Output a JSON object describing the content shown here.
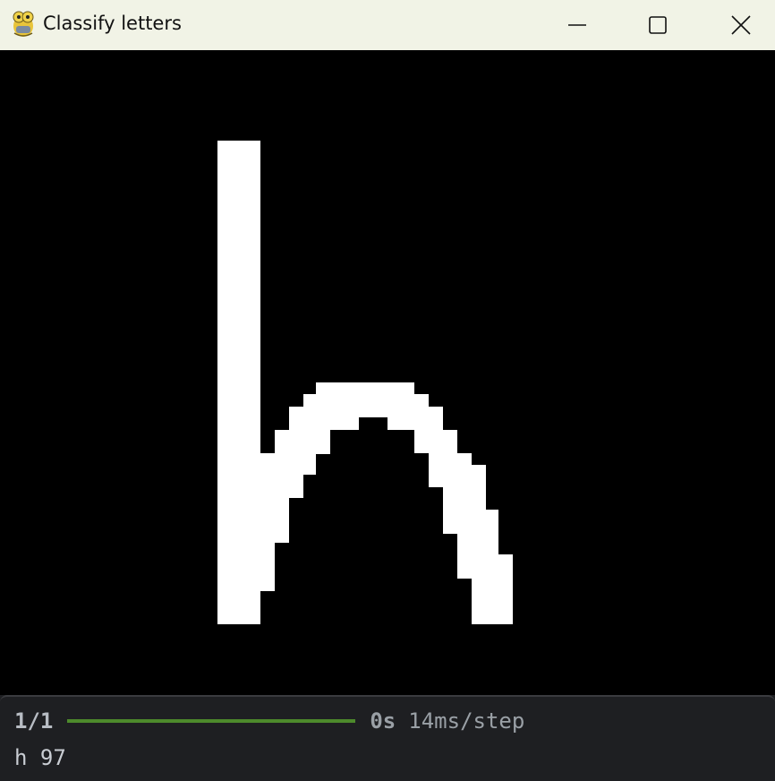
{
  "window": {
    "title": "Classify letters",
    "icon": "python-snake-icon",
    "controls": [
      "minimize-icon",
      "maximize-icon",
      "close-icon"
    ]
  },
  "canvas": {
    "background": "#000000",
    "stroke_color": "#ffffff",
    "drawn_letter": "h"
  },
  "terminal": {
    "step_count": "1/1",
    "progress": 1.0,
    "progress_color": "#4d8a2c",
    "elapsed": "0s",
    "rate": "14ms/step",
    "result": "h 97"
  }
}
